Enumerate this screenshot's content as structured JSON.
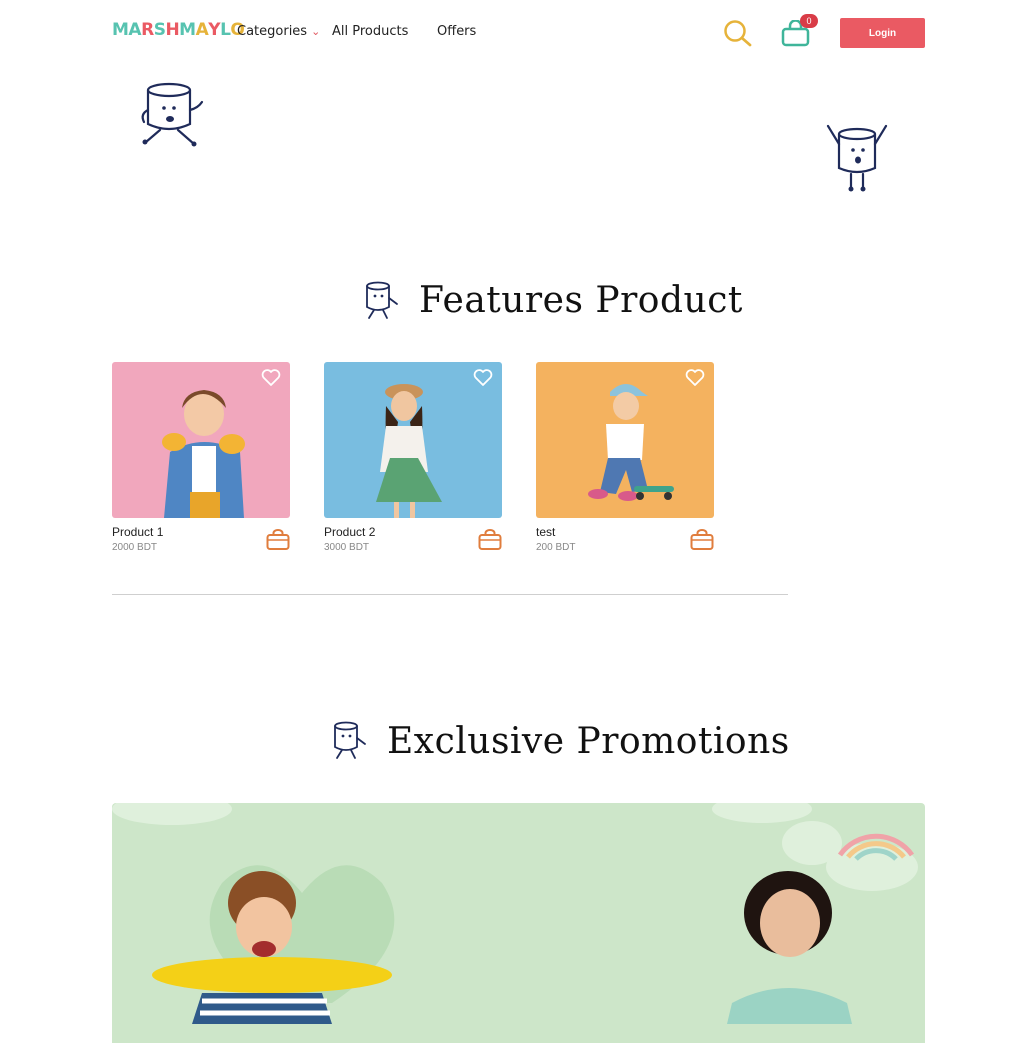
{
  "header": {
    "logo_letters": [
      "M",
      "A",
      "R",
      "S",
      "H",
      "M",
      "A",
      "Y",
      "L",
      "O"
    ],
    "nav": [
      {
        "label": "Categories"
      },
      {
        "label": "All Products"
      },
      {
        "label": "Offers"
      }
    ],
    "cart_count": "0",
    "login_label": "Login"
  },
  "sections": {
    "featured_title": "Features Product",
    "promotions_title": "Exclusive Promotions"
  },
  "products": [
    {
      "name": "Product 1",
      "price": "2000 BDT",
      "bg": "#f1a7bd"
    },
    {
      "name": "Product 2",
      "price": "3000 BDT",
      "bg": "#79bde0"
    },
    {
      "name": "test",
      "price": "200 BDT",
      "bg": "#f4b25f"
    }
  ],
  "colors": {
    "accent": "#ea5a63",
    "search_icon": "#e6b33a",
    "cart_icon": "#3fb59a",
    "bag_icon": "#e07d3d"
  }
}
